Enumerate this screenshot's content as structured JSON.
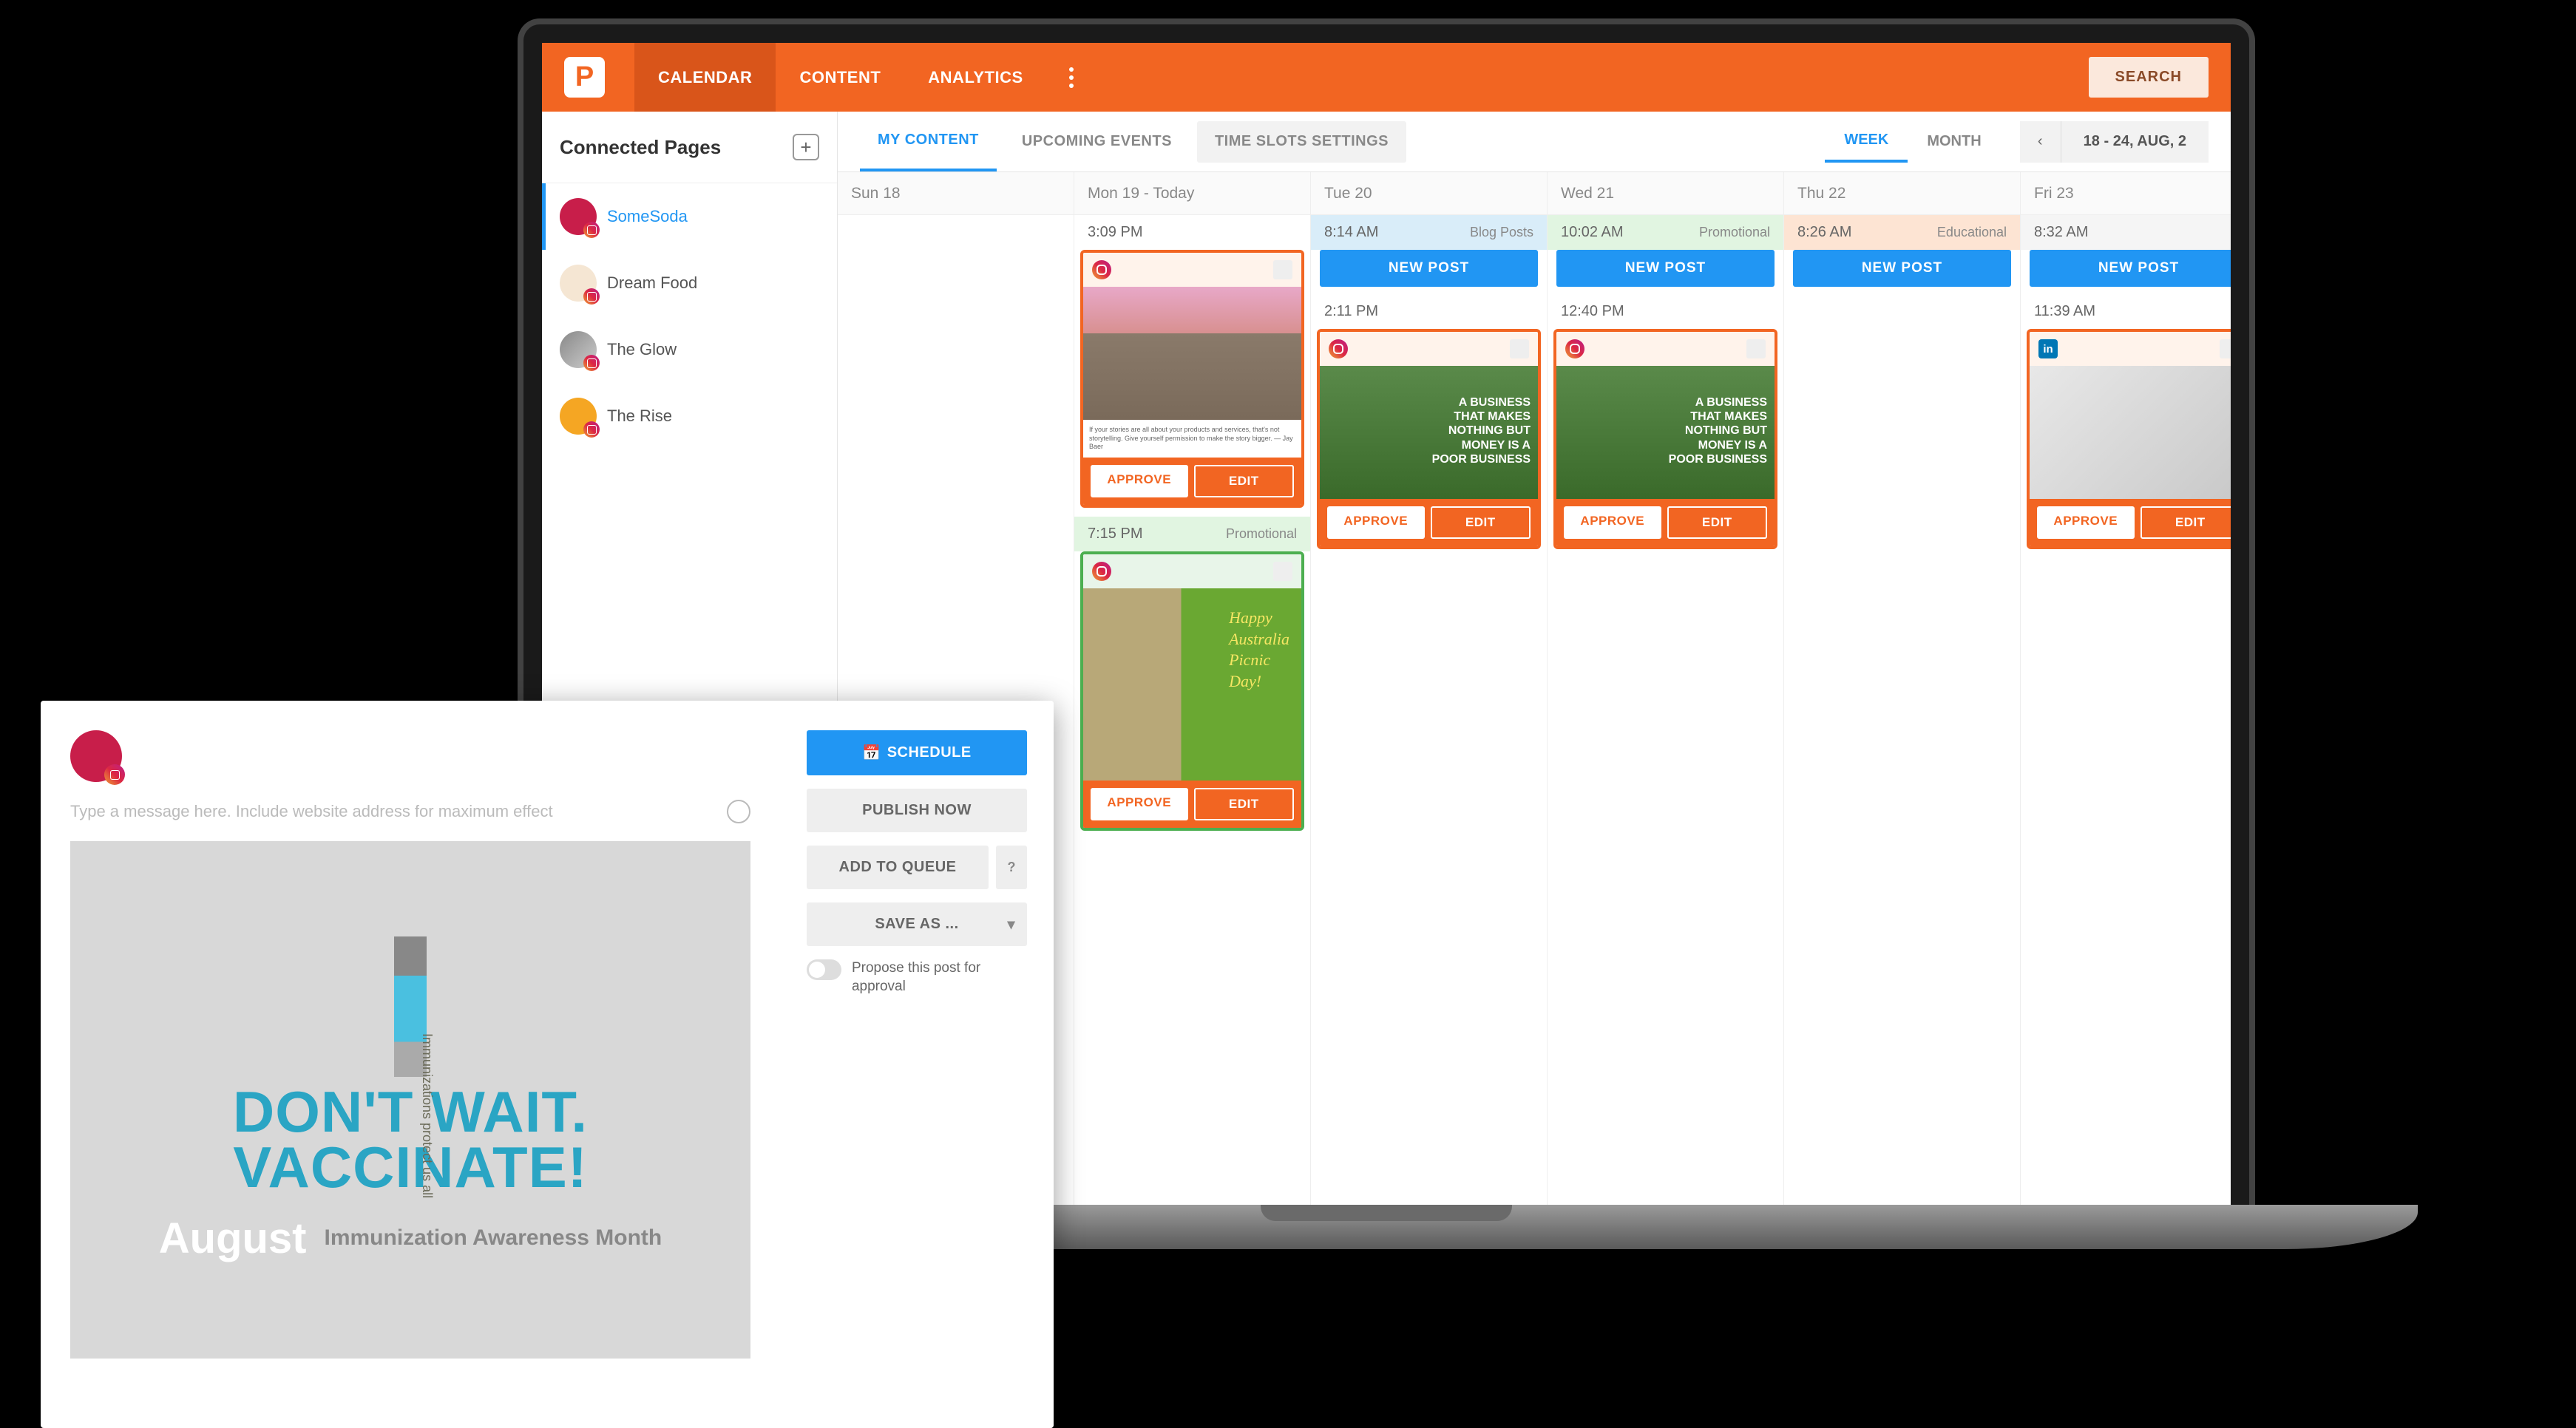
{
  "topbar": {
    "nav": [
      "CALENDAR",
      "CONTENT",
      "ANALYTICS"
    ],
    "search": "SEARCH"
  },
  "sidebar": {
    "title": "Connected Pages",
    "pages": [
      {
        "name": "SomeSoda",
        "active": true
      },
      {
        "name": "Dream Food",
        "active": false
      },
      {
        "name": "The Glow",
        "active": false
      },
      {
        "name": "The Rise",
        "active": false
      }
    ]
  },
  "tabs": {
    "items": [
      "MY CONTENT",
      "UPCOMING EVENTS",
      "TIME SLOTS SETTINGS"
    ],
    "views": [
      "WEEK",
      "MONTH"
    ],
    "range": "18 - 24, AUG, 2"
  },
  "days": [
    {
      "label": "Sun 18"
    },
    {
      "label": "Mon 19 - Today"
    },
    {
      "label": "Tue 20"
    },
    {
      "label": "Wed 21"
    },
    {
      "label": "Thu 22"
    },
    {
      "label": "Fri 23"
    }
  ],
  "slots": {
    "mon": {
      "t1": "3:09 PM",
      "t2": "7:15 PM",
      "cat2": "Promotional"
    },
    "tue": {
      "t1": "8:14 AM",
      "cat1": "Blog Posts",
      "t2": "2:11 PM"
    },
    "wed": {
      "t1": "10:02 AM",
      "cat1": "Promotional",
      "t2": "12:40 PM"
    },
    "thu": {
      "t1": "8:26 AM",
      "cat1": "Educational"
    },
    "fri": {
      "t1": "8:32 AM",
      "t2": "11:39 AM"
    }
  },
  "buttons": {
    "newpost": "NEW POST",
    "approve": "APPROVE",
    "edit": "EDIT"
  },
  "cardText": {
    "business": "A BUSINESS THAT MAKES NOTHING BUT MONEY IS A POOR BUSINESS",
    "picnic": "Happy\nAustralia\nPicnic\nDay!",
    "quote": "If your stories are all about your products and services, that's not storytelling. Give yourself permission to make the story bigger. — Jay Baer"
  },
  "modal": {
    "placeholder": "Type a message here. Include website address for maximum effect",
    "schedule": "SCHEDULE",
    "publish": "PUBLISH NOW",
    "queue": "ADD TO QUEUE",
    "saveas": "SAVE AS ...",
    "propose": "Propose this post for approval",
    "poster": {
      "headline1": "DON'T WAIT.",
      "headline2": "VACCINATE!",
      "month": "August",
      "sub": "Immunization Awareness Month",
      "vertical": "Immunizations protect us all"
    }
  }
}
